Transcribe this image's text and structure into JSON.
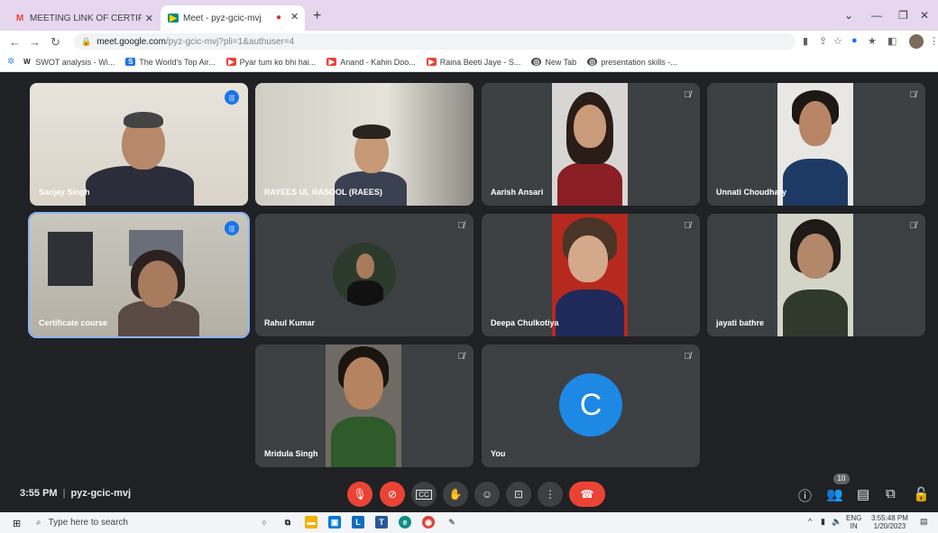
{
  "browser": {
    "tabs": [
      {
        "label": "MEETING LINK OF CERTIFICATE C",
        "icon": "gmail-icon"
      },
      {
        "label": "Meet - pyz-gcic-mvj",
        "icon": "meet-icon"
      }
    ],
    "url_host": "meet.google.com",
    "url_path": "/pyz-gcic-mvj?pli=1&authuser=4",
    "bookmarks": [
      {
        "label": "SWOT analysis - Wi...",
        "icon": "wikipedia-icon",
        "color": "#333333"
      },
      {
        "label": "The World's Top Air...",
        "icon": "s-icon",
        "color": "#1a73e8"
      },
      {
        "label": "Pyar tum ko bhi hai...",
        "icon": "youtube-icon",
        "color": "#ea4335"
      },
      {
        "label": "Anand - Kahin Doo...",
        "icon": "youtube-icon",
        "color": "#ea4335"
      },
      {
        "label": "Raina Beeti Jaye - S...",
        "icon": "youtube-icon",
        "color": "#ea4335"
      },
      {
        "label": "New Tab",
        "icon": "chrome-icon",
        "color": "#333333"
      },
      {
        "label": "presentation skills -...",
        "icon": "chrome-icon",
        "color": "#333333"
      }
    ]
  },
  "meet": {
    "participants": [
      {
        "name": "Sanjay Singh",
        "state": "speaking"
      },
      {
        "name": "RAYEES UL RASOOL (RAEES)",
        "state": "none"
      },
      {
        "name": "Aarish Ansari",
        "state": "muted"
      },
      {
        "name": "Unnati Choudhary",
        "state": "muted"
      },
      {
        "name": "Certificate course",
        "state": "speaking"
      },
      {
        "name": "Rahul Kumar",
        "state": "muted"
      },
      {
        "name": "Deepa Chulkotiya",
        "state": "muted"
      },
      {
        "name": "jayati bathre",
        "state": "muted"
      },
      {
        "name": "Mridula Singh",
        "state": "muted"
      },
      {
        "name": "You",
        "state": "muted",
        "avatar_letter": "C"
      }
    ],
    "time": "3:55 PM",
    "separator": "|",
    "meeting_code": "pyz-gcic-mvj",
    "participant_count": "10",
    "controls": [
      "mic-off-icon",
      "camera-off-icon",
      "captions-icon",
      "raise-hand-icon",
      "emoji-icon",
      "present-icon",
      "more-options-icon",
      "hang-up-icon"
    ]
  },
  "taskbar": {
    "search_placeholder": "Type here to search",
    "language": "ENG",
    "region": "IN",
    "time": "3:55:48 PM",
    "date": "1/20/2023"
  },
  "colors": {
    "accent": "#1a73e8",
    "danger": "#ea4335",
    "tile_bg": "#3c4043",
    "stage_bg": "#202124"
  }
}
